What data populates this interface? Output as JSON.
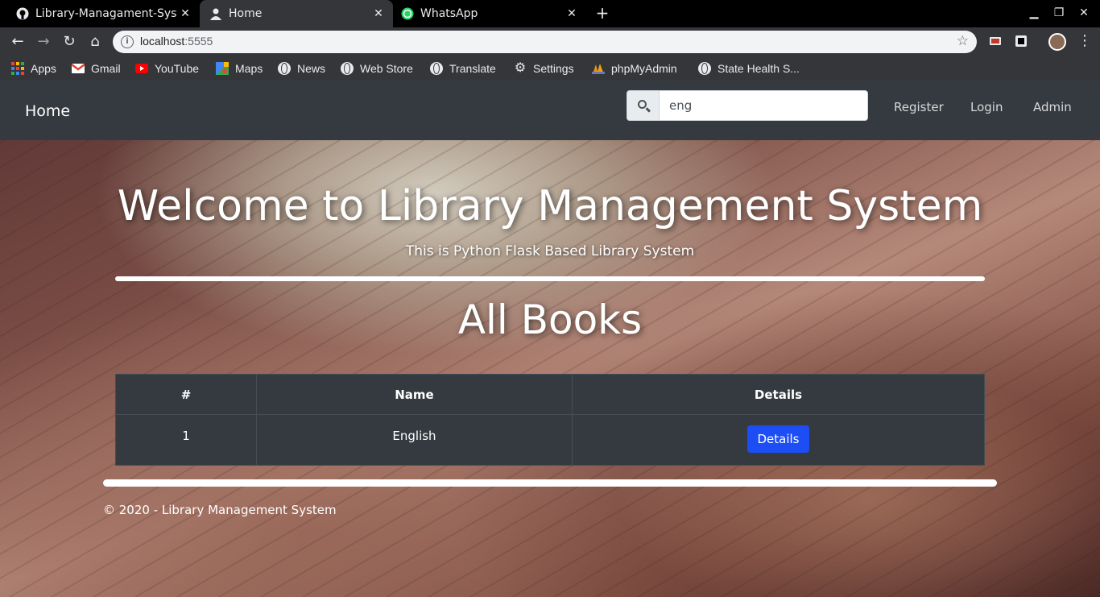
{
  "browser": {
    "tabs": [
      {
        "title": "Library-Managament-Syst",
        "icon": "github-icon",
        "active": false
      },
      {
        "title": "Home",
        "icon": "person-icon",
        "active": true
      },
      {
        "title": "WhatsApp",
        "icon": "whatsapp-icon",
        "active": false
      }
    ],
    "address": {
      "host": "localhost",
      "port": ":5555"
    },
    "bookmarks": [
      {
        "label": "Apps",
        "icon": "apps-grid-icon"
      },
      {
        "label": "Gmail",
        "icon": "gmail-icon"
      },
      {
        "label": "YouTube",
        "icon": "youtube-icon"
      },
      {
        "label": "Maps",
        "icon": "maps-icon"
      },
      {
        "label": "News",
        "icon": "globe-icon"
      },
      {
        "label": "Web Store",
        "icon": "globe-icon"
      },
      {
        "label": "Translate",
        "icon": "globe-icon"
      },
      {
        "label": "Settings",
        "icon": "gear-icon"
      },
      {
        "label": "phpMyAdmin",
        "icon": "phpmyadmin-icon"
      },
      {
        "label": "State Health S...",
        "icon": "globe-icon"
      }
    ]
  },
  "navbar": {
    "brand": "Home",
    "search_value": "eng",
    "links": [
      "Register",
      "Login",
      "Admin"
    ]
  },
  "hero": {
    "title": "Welcome to Library Management System",
    "subtitle": "This is Python Flask Based Library System"
  },
  "books": {
    "title": "All Books",
    "headers": [
      "#",
      "Name",
      "Details"
    ],
    "rows": [
      {
        "num": "1",
        "name": "English",
        "button": "Details"
      }
    ]
  },
  "footer": {
    "text": "© 2020 - Library Management System"
  },
  "colors": {
    "navbar": "#343a40",
    "button": "#1d4ef5"
  }
}
